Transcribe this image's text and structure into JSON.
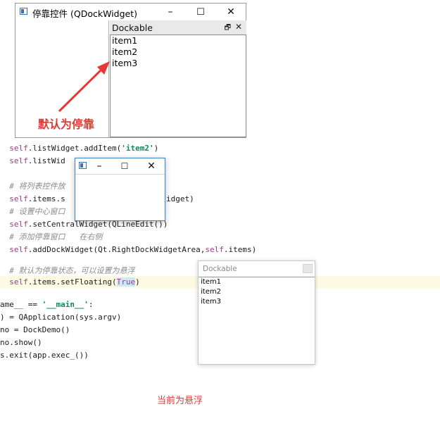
{
  "main_window": {
    "title": "停靠控件 (QDockWidget)",
    "dock": {
      "title": "Dockable",
      "float_icon": "float-icon",
      "close_icon": "close-icon"
    },
    "items": [
      "item1",
      "item2",
      "item3"
    ]
  },
  "annotations": {
    "docked_label": "默认为停靠",
    "floating_label": "当前为悬浮"
  },
  "code": {
    "line1_a": "self",
    "line1_b": ".listWidget.addItem(",
    "line1_c": "'item2'",
    "line1_d": ")",
    "line2_a": "self",
    "line2_b": ".listWid",
    "line4": "# 将列表控件放",
    "line5_a": "self",
    "line5_b": ".items.s",
    "line5_c": "idget)",
    "line6": "# 设置中心窗口",
    "line7_a": "self",
    "line7_b": ".setCentralWidget(QLineEdit())",
    "line8": "# 添加停靠窗口   在右侧",
    "line9_a": "self",
    "line9_b": ".addDockWidget(Qt.RightDockWidgetArea,",
    "line9_c": "self",
    "line9_d": ".items)",
    "line11": "# 默认为停靠状态，可以设置为悬浮",
    "line12_a": "self",
    "line12_b": ".items.setFloating(",
    "line12_c": "True",
    "line12_d": ")",
    "line13_a": "ame__ == ",
    "line13_b": "'__main__'",
    "line13_c": ":",
    "line14": ") = QApplication(sys.argv)",
    "line15": "no = DockDemo()",
    "line16": "no.show()",
    "line17": "s.exit(app.exec_())"
  },
  "floating_window": {
    "min_symbol": "–",
    "max_symbol": "☐",
    "close_symbol": "✕"
  },
  "floating_dock": {
    "title": "Dockable",
    "items": [
      "item1",
      "item2",
      "item3"
    ]
  },
  "window_buttons": {
    "min": "–",
    "max": "☐",
    "close": "✕"
  },
  "colors": {
    "annotation_red": "#e53935",
    "keyword": "#9b3d8a",
    "string": "#0a8a62",
    "highlight": "#fdfbe4"
  }
}
